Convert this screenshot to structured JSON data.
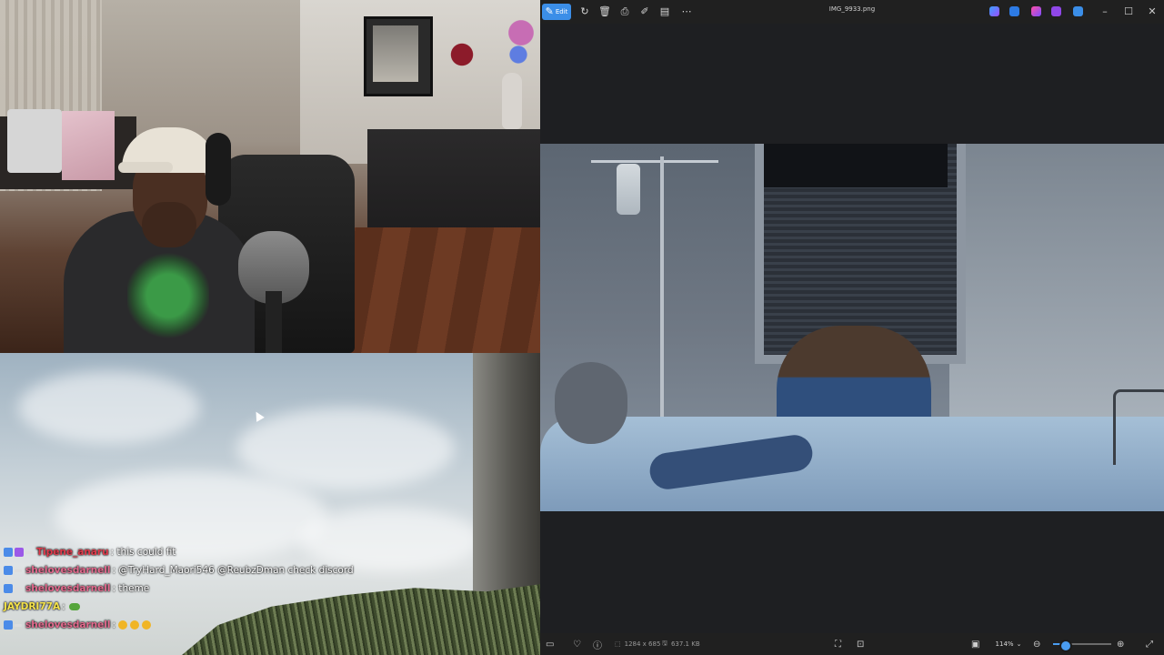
{
  "chat": [
    {
      "badges": [
        "blue",
        "purple",
        "dash"
      ],
      "user": "Tipene_anaru",
      "user_color": "#e03a4b",
      "message": ": this could fit"
    },
    {
      "badges": [
        "blue",
        "dash"
      ],
      "user": "shelovesdarnell",
      "user_color": "#e36a8e",
      "message": ": @TryHard_Maori546 @ReubzDman check discord"
    },
    {
      "badges": [
        "blue",
        "dash"
      ],
      "user": "shelovesdarnell",
      "user_color": "#e36a8e",
      "message": ": theme"
    },
    {
      "badges": [],
      "user": "JAYDRI77A",
      "user_color": "#f5e34a",
      "message": ":",
      "emote": "frog-emote"
    },
    {
      "badges": [
        "blue",
        "dash"
      ],
      "user": "shelovesdarnell",
      "user_color": "#e36a8e",
      "message": ":",
      "emote": "heart-eyes-emote x3"
    }
  ],
  "viewer": {
    "edit_label": "Edit",
    "title": "IMG_9933.png",
    "toolbar_icons": [
      "rotate-icon",
      "delete-icon",
      "print-icon",
      "edit-icon",
      "info-icon",
      "more-icon"
    ],
    "status": {
      "dimensions": "1284 x 685",
      "file_size": "637.1 KB",
      "zoom": "114%",
      "zoom_level": 0.18
    }
  },
  "colors": {
    "accent": "#3b8ee8",
    "viewer_bg": "#202020"
  }
}
